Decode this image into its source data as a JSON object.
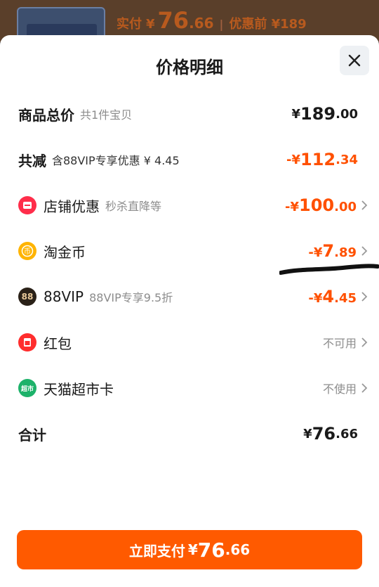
{
  "background": {
    "paid_label": "实付",
    "currency": "¥",
    "paid_int": "76",
    "paid_dec": ".66",
    "separator": "|",
    "original_label": "优惠前 ¥189"
  },
  "sheet": {
    "title": "价格明细",
    "close_icon": "close-icon"
  },
  "rows": {
    "total": {
      "label": "商品总价",
      "sub": "共1件宝贝",
      "yen": "¥",
      "int": "189",
      "dec": ".00"
    },
    "reduced": {
      "label": "共减",
      "sub": "含88VIP专享优惠 ¥ 4.45",
      "yen": "-¥",
      "int": "112",
      "dec": ".34"
    },
    "store": {
      "icon": "store-discount-icon",
      "label": "店铺优惠",
      "sub": "秒杀直降等",
      "yen": "-¥",
      "int": "100",
      "dec": ".00"
    },
    "coins": {
      "icon": "gold-coin-icon",
      "label": "淘金币",
      "yen": "-¥",
      "int": "7",
      "dec": ".89"
    },
    "vip": {
      "icon": "88vip-icon",
      "icon_text": "88",
      "label": "88VIP",
      "sub": "88VIP专享9.5折",
      "yen": "-¥",
      "int": "4",
      "dec": ".45"
    },
    "redpacket": {
      "icon": "red-packet-icon",
      "label": "红包",
      "status": "不可用"
    },
    "tmall_card": {
      "icon": "tmall-supermarket-icon",
      "icon_text": "超市",
      "label": "天猫超市卡",
      "status": "不使用"
    },
    "sum": {
      "label": "合计",
      "yen": "¥",
      "int": "76",
      "dec": ".66"
    }
  },
  "pay_button": {
    "label": "立即支付",
    "yen": "¥",
    "int": "76",
    "dec": ".66"
  },
  "colors": {
    "accent": "#ff5000",
    "button": "#ff5a00",
    "text": "#1a1a1a",
    "muted": "#8c8c8c"
  }
}
